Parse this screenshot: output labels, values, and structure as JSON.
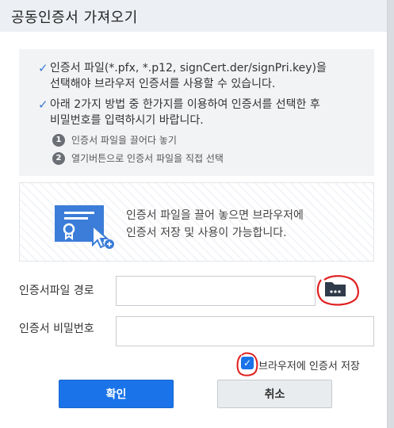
{
  "dialog": {
    "title": "공동인증서 가져오기"
  },
  "notice": {
    "bullets": [
      "인증서 파일(*.pfx, *.p12, signCert.der/signPri.key)을\n선택해야 브라우저 인증서를 사용할 수 있습니다.",
      "아래 2가지 방법 중 한가지를 이용하여 인증서를 선택한 후\n비밀번호를 입력하시기 바랍니다."
    ],
    "steps": [
      {
        "num": "1",
        "text": "인증서 파일을 끌어다 놓기"
      },
      {
        "num": "2",
        "text": "열기버튼으로 인증서 파일을 직접 선택"
      }
    ]
  },
  "dropzone": {
    "text": "인증서 파일을 끌어 놓으면 브라우저에\n인증서 저장 및 사용이 가능합니다."
  },
  "form": {
    "path_label": "인증서파일 경로",
    "path_value": "",
    "password_label": "인증서 비밀번호",
    "password_value": "",
    "save_label": "브라우저에 인증서 저장",
    "save_checked": true
  },
  "buttons": {
    "ok_label": "확인",
    "cancel_label": "취소"
  },
  "colors": {
    "accent": "#1a73e8",
    "annotation": "#e02020"
  }
}
